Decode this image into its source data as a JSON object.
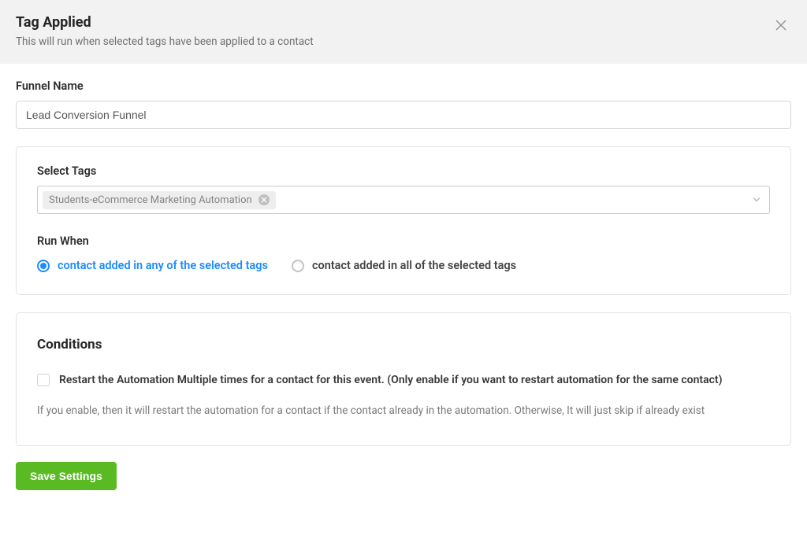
{
  "header": {
    "title": "Tag Applied",
    "subtitle": "This will run when selected tags have been applied to a contact"
  },
  "funnel_name": {
    "label": "Funnel Name",
    "value": "Lead Conversion Funnel"
  },
  "select_tags": {
    "label": "Select Tags",
    "chip": "Students-eCommerce Marketing Automation"
  },
  "run_when": {
    "label": "Run When",
    "options": {
      "any": "contact added in any of the selected tags",
      "all": "contact added in all of the selected tags"
    }
  },
  "conditions": {
    "title": "Conditions",
    "checkbox_label": "Restart the Automation Multiple times for a contact for this event. (Only enable if you want to restart automation for the same contact)",
    "help_text": "If you enable, then it will restart the automation for a contact if the contact already in the automation. Otherwise, It will just skip if already exist"
  },
  "footer": {
    "save_label": "Save Settings"
  }
}
